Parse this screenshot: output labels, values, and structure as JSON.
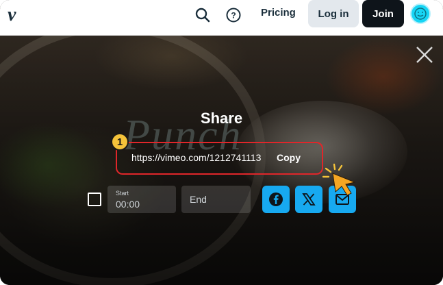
{
  "nav": {
    "logo": "v",
    "search_icon": "search-icon",
    "help_icon": "help-circle-icon",
    "pricing_label": "Pricing",
    "login_label": "Log in",
    "join_label": "Join",
    "avatar_icon": "smiley-face-icon",
    "accent_color": "#17d5f5"
  },
  "share": {
    "title": "Share",
    "wordmark": "Punch",
    "url": "https://vimeo.com/1212741113",
    "copy_label": "Copy",
    "step_number": "1",
    "start_label": "Start",
    "start_value": "00:00",
    "end_placeholder": "End",
    "social_buttons": [
      {
        "icon": "facebook-icon"
      },
      {
        "icon": "x-twitter-icon"
      },
      {
        "icon": "email-icon"
      }
    ],
    "social_color": "#17a9f0",
    "highlight_color": "#e0262a",
    "badge_color": "#f5c33a"
  },
  "overlay": {
    "close_icon": "close-icon"
  }
}
